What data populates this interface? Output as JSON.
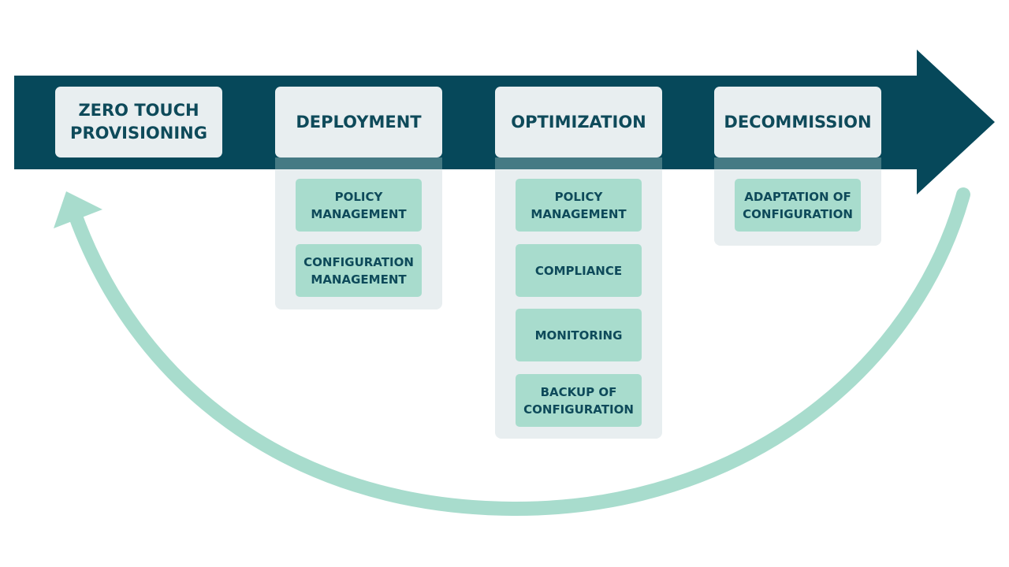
{
  "colors": {
    "arrow": "#06485a",
    "cycle_arrow": "#a8dccd",
    "header_box": "#e8eef0",
    "item_box": "#a8dccd",
    "text": "#0e4a5a"
  },
  "stages": [
    {
      "title": "ZERO TOUCH PROVISIONING",
      "items": []
    },
    {
      "title": "DEPLOYMENT",
      "items": [
        "POLICY MANAGEMENT",
        "CONFIGURATION MANAGEMENT"
      ]
    },
    {
      "title": "OPTIMIZATION",
      "items": [
        "POLICY MANAGEMENT",
        "COMPLIANCE",
        "MONITORING",
        "BACKUP OF CONFIGURATION"
      ]
    },
    {
      "title": "DECOMMISSION",
      "items": [
        "ADAPTATION OF CONFIGURATION"
      ]
    }
  ]
}
